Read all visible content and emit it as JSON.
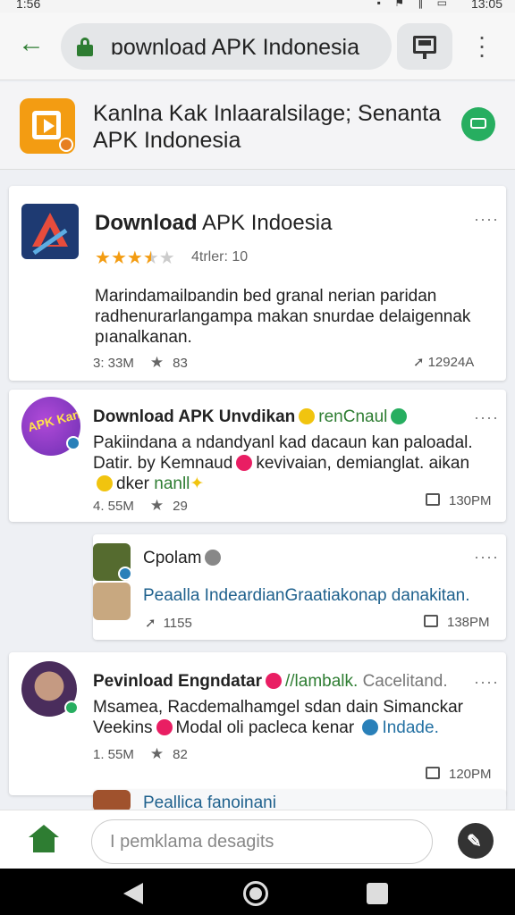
{
  "status_bar": {
    "time_left": "1:56",
    "time_right": "13:05"
  },
  "url_bar": {
    "url_text": "ɒownload APK Indonesia"
  },
  "app_header": {
    "title": "Kanlna Kak Inlaaralsilage; Senanta APK Indonesia"
  },
  "main_card": {
    "title_bold": "Download",
    "title_rest": " APK Indoesia",
    "stars": 3.5,
    "rating_text": "4trler: 10",
    "description": "Marindamailɒandin bed granal nerian paridan radhenurarlangampa makan snurdae delaigennak pıanalkanan.",
    "meta_left": "3: 33M",
    "meta_count": "83",
    "meta_right": "12924A"
  },
  "post1": {
    "avatar_text": "APK Kanlan",
    "title_bold": "Download APK Unvdikan",
    "title_tag": "renCnaul",
    "body_1": "Pakiindana a ndandyanl kad dacaun kan paloadal.",
    "body_2a": "Datir. by Kemnaud",
    "body_2b": "kevivaian, demianglat. aikan",
    "body_3a": "dker",
    "body_3b": "nanll",
    "meta_left": "4. 55M",
    "meta_count": "29",
    "meta_right": "130PM"
  },
  "reply1": {
    "name": "Cpolam",
    "text": "Peaalla IndeardianGraatiakonap danakitan.",
    "meta_left": "1155",
    "meta_right": "138PM"
  },
  "post2": {
    "title_bold": "Pevinload Engndatar",
    "title_tag": "//lambalk.",
    "title_gray": "Cacelitand.",
    "body_1": "Msamea, Racdemalhamgel sdan dain Simanckar",
    "body_2a": "Veekins",
    "body_2b": "Modal oli pacleca kenar",
    "body_2c": "Indade.",
    "meta_left": "1. 55M",
    "meta_count": "82",
    "meta_right": "120PM"
  },
  "reply2": {
    "text": "Peallica fanoinani"
  },
  "compose": {
    "placeholder": "I pemklama desagits"
  },
  "colors": {
    "accent_green": "#2e7d32",
    "app_orange": "#f39c12",
    "link_blue": "#1f618d"
  }
}
